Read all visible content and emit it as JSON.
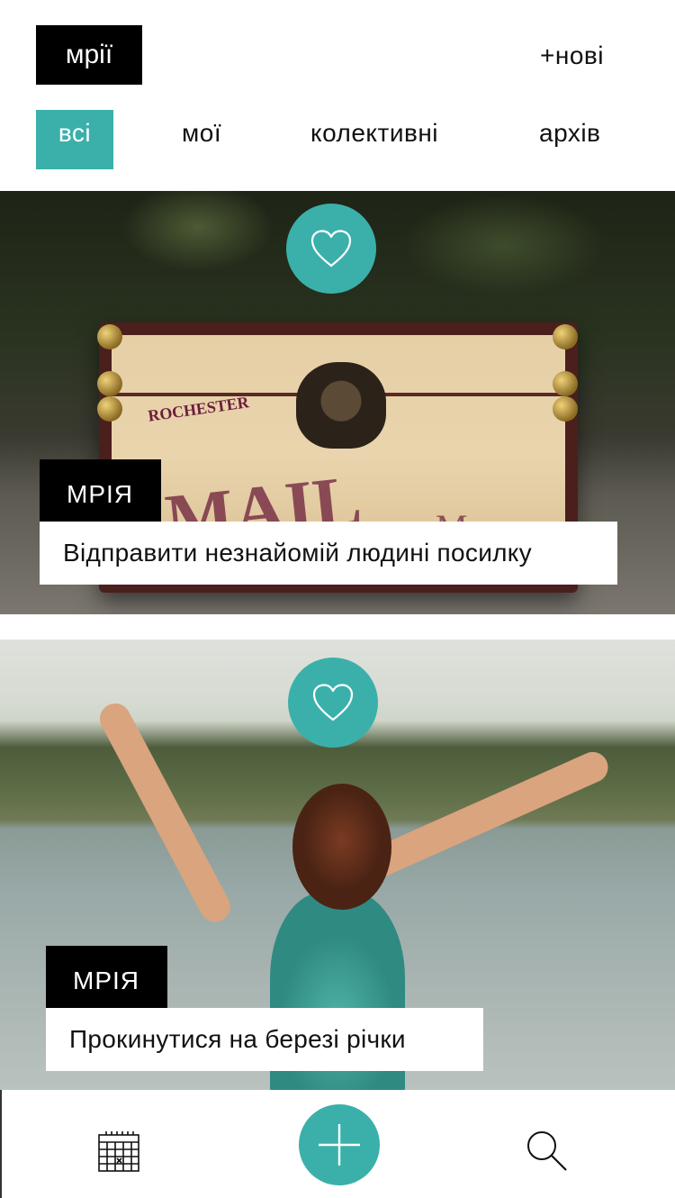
{
  "header": {
    "logo": "мрії",
    "new_button": "+нові"
  },
  "tabs": [
    {
      "label": "всі",
      "active": true
    },
    {
      "label": "мої",
      "active": false
    },
    {
      "label": "колективні",
      "active": false
    },
    {
      "label": "архів",
      "active": false
    }
  ],
  "cards": [
    {
      "tag": "МРІЯ",
      "title": "Відправити незнайомій людині посилку",
      "image": "suitcase-photo",
      "suitcase_text": {
        "stamp": "ROCHESTER",
        "big": "MAIL",
        "script": "Marc"
      }
    },
    {
      "tag": "МРІЯ",
      "title": "Прокинутися на березі річки",
      "image": "woman-by-river-photo"
    }
  ],
  "bottom_bar": {
    "calendar": "calendar-icon",
    "add": "plus-icon",
    "search": "search-icon"
  },
  "colors": {
    "accent": "#3bb0ab",
    "dark": "#000000",
    "background": "#ffffff"
  }
}
